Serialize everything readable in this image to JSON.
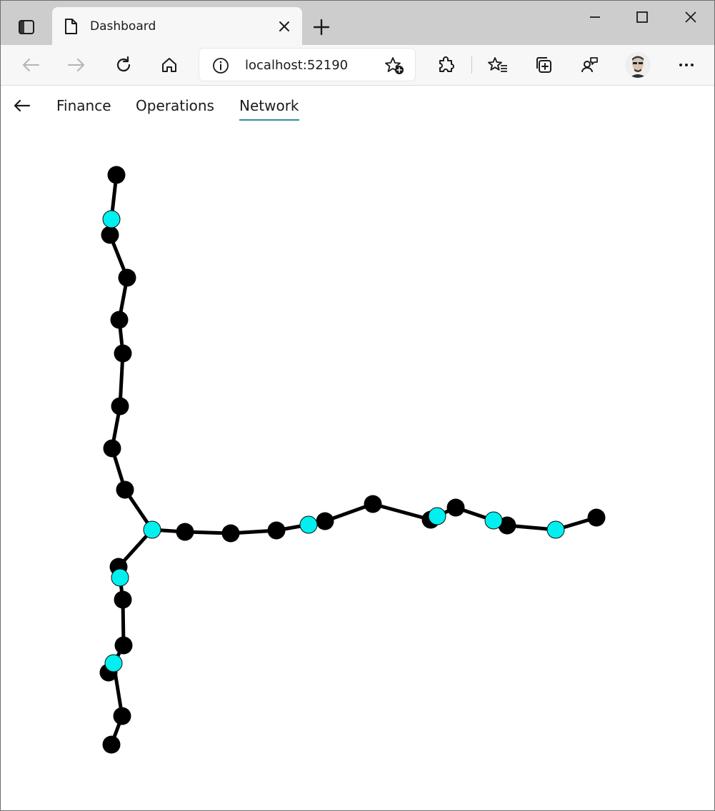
{
  "browser": {
    "tab_title": "Dashboard",
    "url": "localhost:52190",
    "icons": {
      "tab_actions": "tab-actions-icon",
      "page": "page-icon",
      "close": "close-icon",
      "new_tab": "plus-icon",
      "back": "back-arrow-icon",
      "forward": "forward-arrow-icon",
      "refresh": "refresh-icon",
      "home": "home-icon",
      "info": "info-icon",
      "add_favorite": "star-plus-icon",
      "extensions": "puzzle-icon",
      "favorites": "favorites-list-icon",
      "collections": "collections-icon",
      "feedback": "people-icon",
      "profile": "avatar",
      "menu": "more-icon"
    }
  },
  "app": {
    "tabs": [
      {
        "label": "Finance",
        "active": false
      },
      {
        "label": "Operations",
        "active": false
      },
      {
        "label": "Network",
        "active": true
      }
    ],
    "accent_color": "#2f8fa0"
  },
  "network": {
    "colors": {
      "node": "#000000",
      "highlight": "#00f0f0",
      "edge": "#000000"
    },
    "nodes": [
      {
        "id": "a1",
        "highlight": false
      },
      {
        "id": "a2",
        "highlight": true
      },
      {
        "id": "a3",
        "highlight": false
      },
      {
        "id": "a4",
        "highlight": false
      },
      {
        "id": "a5",
        "highlight": false
      },
      {
        "id": "a6",
        "highlight": false
      },
      {
        "id": "a7",
        "highlight": false
      },
      {
        "id": "a8",
        "highlight": false
      },
      {
        "id": "a9",
        "highlight": false
      },
      {
        "id": "hub",
        "highlight": true
      },
      {
        "id": "b1",
        "highlight": false
      },
      {
        "id": "b2",
        "highlight": false
      },
      {
        "id": "b3",
        "highlight": false
      },
      {
        "id": "b4",
        "highlight": true
      },
      {
        "id": "b5",
        "highlight": false
      },
      {
        "id": "b6",
        "highlight": false
      },
      {
        "id": "b7",
        "highlight": false
      },
      {
        "id": "b8",
        "highlight": true
      },
      {
        "id": "b9",
        "highlight": false
      },
      {
        "id": "b10",
        "highlight": true
      },
      {
        "id": "b11",
        "highlight": false
      },
      {
        "id": "b12",
        "highlight": true
      },
      {
        "id": "b13",
        "highlight": false
      },
      {
        "id": "c1",
        "highlight": false
      },
      {
        "id": "c2",
        "highlight": true
      },
      {
        "id": "c3",
        "highlight": false
      },
      {
        "id": "c4",
        "highlight": false
      },
      {
        "id": "c5",
        "highlight": false
      },
      {
        "id": "c6",
        "highlight": true
      },
      {
        "id": "c7",
        "highlight": false
      },
      {
        "id": "c8",
        "highlight": false
      }
    ],
    "edges": [
      [
        "a1",
        "a2"
      ],
      [
        "a2",
        "a3"
      ],
      [
        "a3",
        "a4"
      ],
      [
        "a4",
        "a5"
      ],
      [
        "a5",
        "a6"
      ],
      [
        "a6",
        "a7"
      ],
      [
        "a7",
        "a8"
      ],
      [
        "a8",
        "a9"
      ],
      [
        "a9",
        "hub"
      ],
      [
        "hub",
        "b1"
      ],
      [
        "b1",
        "b2"
      ],
      [
        "b2",
        "b3"
      ],
      [
        "b3",
        "b4"
      ],
      [
        "b4",
        "b5"
      ],
      [
        "b5",
        "b6"
      ],
      [
        "b6",
        "b7"
      ],
      [
        "b7",
        "b8"
      ],
      [
        "b8",
        "b9"
      ],
      [
        "b9",
        "b10"
      ],
      [
        "b10",
        "b11"
      ],
      [
        "b11",
        "b12"
      ],
      [
        "b12",
        "b13"
      ],
      [
        "hub",
        "c1"
      ],
      [
        "c1",
        "c2"
      ],
      [
        "c2",
        "c3"
      ],
      [
        "c3",
        "c4"
      ],
      [
        "c4",
        "c5"
      ],
      [
        "c5",
        "c6"
      ],
      [
        "c6",
        "c7"
      ],
      [
        "c7",
        "c8"
      ]
    ]
  }
}
